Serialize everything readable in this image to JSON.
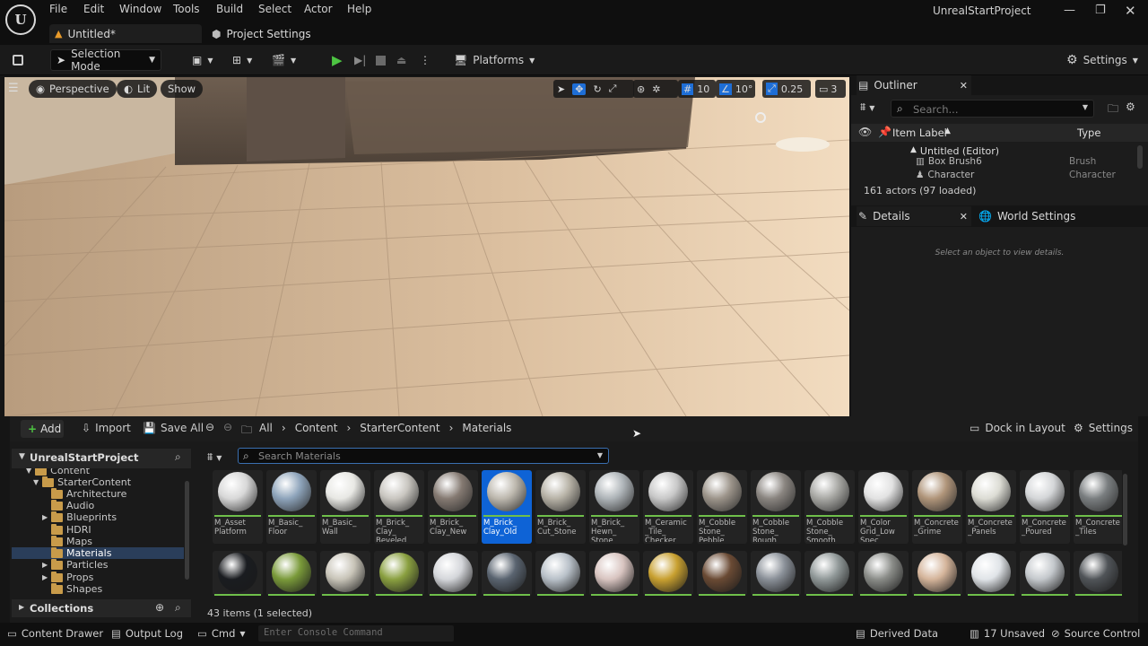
{
  "menu": [
    "File",
    "Edit",
    "Window",
    "Tools",
    "Build",
    "Select",
    "Actor",
    "Help"
  ],
  "project_name": "UnrealStartProject",
  "tabs": {
    "level_tab": "Untitled*",
    "project_settings": "Project Settings"
  },
  "toolbar": {
    "mode": "Selection Mode",
    "platforms": "Platforms",
    "settings": "Settings"
  },
  "viewport": {
    "perspective": "Perspective",
    "lit": "Lit",
    "show": "Show",
    "grid_snap": "10",
    "rot_snap": "10°",
    "scale_snap": "0.25",
    "cam_speed": "3"
  },
  "outliner": {
    "title": "Outliner",
    "search_placeholder": "Search...",
    "col_label": "Item Label",
    "col_type": "Type",
    "rows": [
      {
        "label": "Untitled (Editor)",
        "type": ""
      },
      {
        "label": "Box Brush6",
        "type": "Brush"
      },
      {
        "label": "Character",
        "type": "Character"
      }
    ],
    "count": "161 actors (97 loaded)"
  },
  "details": {
    "title": "Details",
    "world_settings": "World Settings",
    "empty_msg": "Select an object to view details."
  },
  "content_browser": {
    "add": "Add",
    "import": "Import",
    "save_all": "Save All",
    "breadcrumb": [
      "All",
      "Content",
      "StarterContent",
      "Materials"
    ],
    "dock": "Dock in Layout",
    "settings": "Settings",
    "search_placeholder": "Search Materials",
    "tree_root": "UnrealStartProject",
    "tree": [
      {
        "label": "Content",
        "depth": 0
      },
      {
        "label": "StarterContent",
        "depth": 1
      },
      {
        "label": "Architecture",
        "depth": 2
      },
      {
        "label": "Audio",
        "depth": 2
      },
      {
        "label": "Blueprints",
        "depth": 2
      },
      {
        "label": "HDRI",
        "depth": 2
      },
      {
        "label": "Maps",
        "depth": 2
      },
      {
        "label": "Materials",
        "depth": 2
      },
      {
        "label": "Particles",
        "depth": 2
      },
      {
        "label": "Props",
        "depth": 2
      },
      {
        "label": "Shapes",
        "depth": 2
      }
    ],
    "collections": "Collections",
    "items_count": "43 items (1 selected)",
    "assets": [
      {
        "name": "M_Asset Platform",
        "color": "#d8d8d8"
      },
      {
        "name": "M_Basic_ Floor",
        "color": "#8ea4bb"
      },
      {
        "name": "M_Basic_ Wall",
        "color": "#e8e8e4"
      },
      {
        "name": "M_Brick_ Clay_ Beveled",
        "color": "#c9c6c0"
      },
      {
        "name": "M_Brick_ Clay_New",
        "color": "#857a72"
      },
      {
        "name": "M_Brick_ Clay_Old",
        "color": "#bdb8ae"
      },
      {
        "name": "M_Brick_ Cut_Stone",
        "color": "#b7b2a6"
      },
      {
        "name": "M_Brick_ Hewn_ Stone",
        "color": "#aeb4b8"
      },
      {
        "name": "M_Ceramic _Tile_ Checker",
        "color": "#c8c8c8"
      },
      {
        "name": "M_Cobble Stone_ Pebble",
        "color": "#9c948a"
      },
      {
        "name": "M_Cobble Stone_ Rough",
        "color": "#8a8580"
      },
      {
        "name": "M_Cobble Stone_ Smooth",
        "color": "#a8a8a4"
      },
      {
        "name": "M_Color Grid_Low Spec",
        "color": "#e2e2e2"
      },
      {
        "name": "M_Concrete _Grime",
        "color": "#b0957a"
      },
      {
        "name": "M_Concrete _Panels",
        "color": "#dcdcd4"
      },
      {
        "name": "M_Concrete _Poured",
        "color": "#d4d6d8"
      },
      {
        "name": "M_Concrete _Tiles",
        "color": "#7a7e80"
      }
    ],
    "row2_colors": [
      "#1a1c20",
      "#7a9a3a",
      "#c8c4b8",
      "#8aa040",
      "#d4d6da",
      "#5a6470",
      "#b8c0c8",
      "#d8c4c0",
      "#c8a030",
      "#6a4a34",
      "#8a9098",
      "#909898",
      "#8a8c88",
      "#d4b49a",
      "#e0e4e8",
      "#c4c8cc",
      "#505458"
    ]
  },
  "statusbar": {
    "content_drawer": "Content Drawer",
    "output_log": "Output Log",
    "cmd": "Cmd",
    "console_placeholder": "Enter Console Command",
    "derived": "Derived Data",
    "unsaved": "17 Unsaved",
    "source_control": "Source Control"
  }
}
